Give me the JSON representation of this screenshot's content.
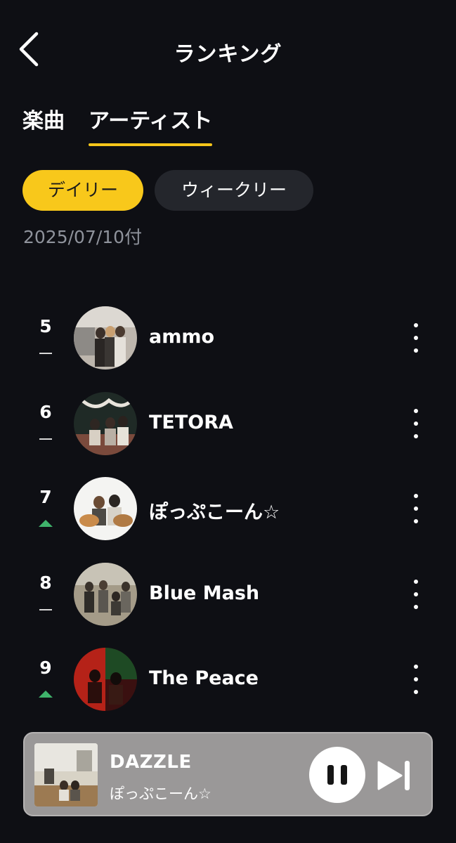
{
  "header": {
    "title": "ランキング"
  },
  "tabs": [
    {
      "label": "楽曲",
      "active": false
    },
    {
      "label": "アーティスト",
      "active": true
    }
  ],
  "period_pills": [
    {
      "label": "デイリー",
      "selected": true
    },
    {
      "label": "ウィークリー",
      "selected": false
    }
  ],
  "date_label": "2025/07/10付",
  "rankings": [
    {
      "rank": "5",
      "trend": "flat",
      "name": "ammo"
    },
    {
      "rank": "6",
      "trend": "flat",
      "name": "TETORA"
    },
    {
      "rank": "7",
      "trend": "up",
      "name": "ぽっぷこーん☆"
    },
    {
      "rank": "8",
      "trend": "flat",
      "name": "Blue Mash"
    },
    {
      "rank": "9",
      "trend": "up",
      "name": "The Peace"
    }
  ],
  "now_playing": {
    "title": "DAZZLE",
    "artist": "ぽっぷこーん☆"
  },
  "colors": {
    "background": "#0e0f14",
    "accent": "#f6c61a",
    "trend_up": "#3fb36b",
    "date_text": "#8f939c"
  },
  "icons": {
    "back": "chevron-left-icon",
    "more": "more-vertical-icon",
    "trend_flat": "dash-icon",
    "trend_up": "triangle-up-icon",
    "pause": "pause-icon",
    "next": "skip-next-icon"
  }
}
